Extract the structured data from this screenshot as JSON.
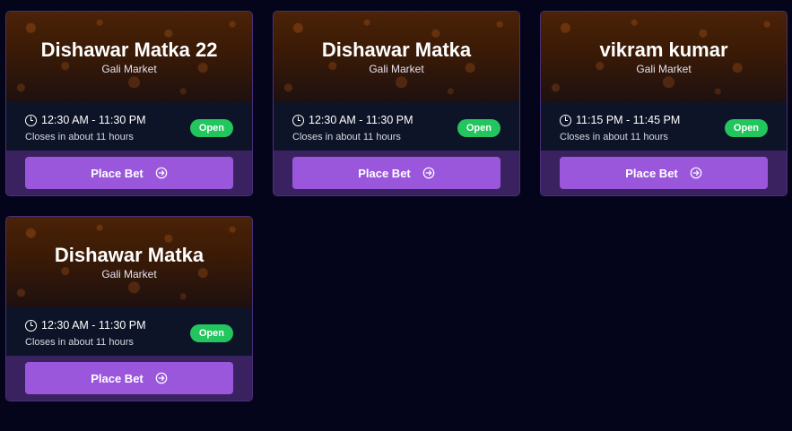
{
  "cards": [
    {
      "title": "Dishawar Matka 22",
      "market": "Gali Market",
      "time": "12:30 AM - 11:30 PM",
      "closes": "Closes in about 11 hours",
      "status": "Open",
      "button": "Place Bet"
    },
    {
      "title": "Dishawar Matka",
      "market": "Gali Market",
      "time": "12:30 AM - 11:30 PM",
      "closes": "Closes in about 11 hours",
      "status": "Open",
      "button": "Place Bet"
    },
    {
      "title": "vikram kumar",
      "market": "Gali Market",
      "time": "11:15 PM - 11:45 PM",
      "closes": "Closes in about 11 hours",
      "status": "Open",
      "button": "Place Bet"
    },
    {
      "title": "Dishawar Matka",
      "market": "Gali Market",
      "time": "12:30 AM - 11:30 PM",
      "closes": "Closes in about 11 hours",
      "status": "Open",
      "button": "Place Bet"
    }
  ],
  "icons": {
    "time": "clock-icon",
    "button": "arrow-right-circle-icon"
  },
  "colors": {
    "background": "#04051a",
    "status_open": "#22c55e",
    "button": "#9b57dc",
    "banner": "#4a2207"
  }
}
